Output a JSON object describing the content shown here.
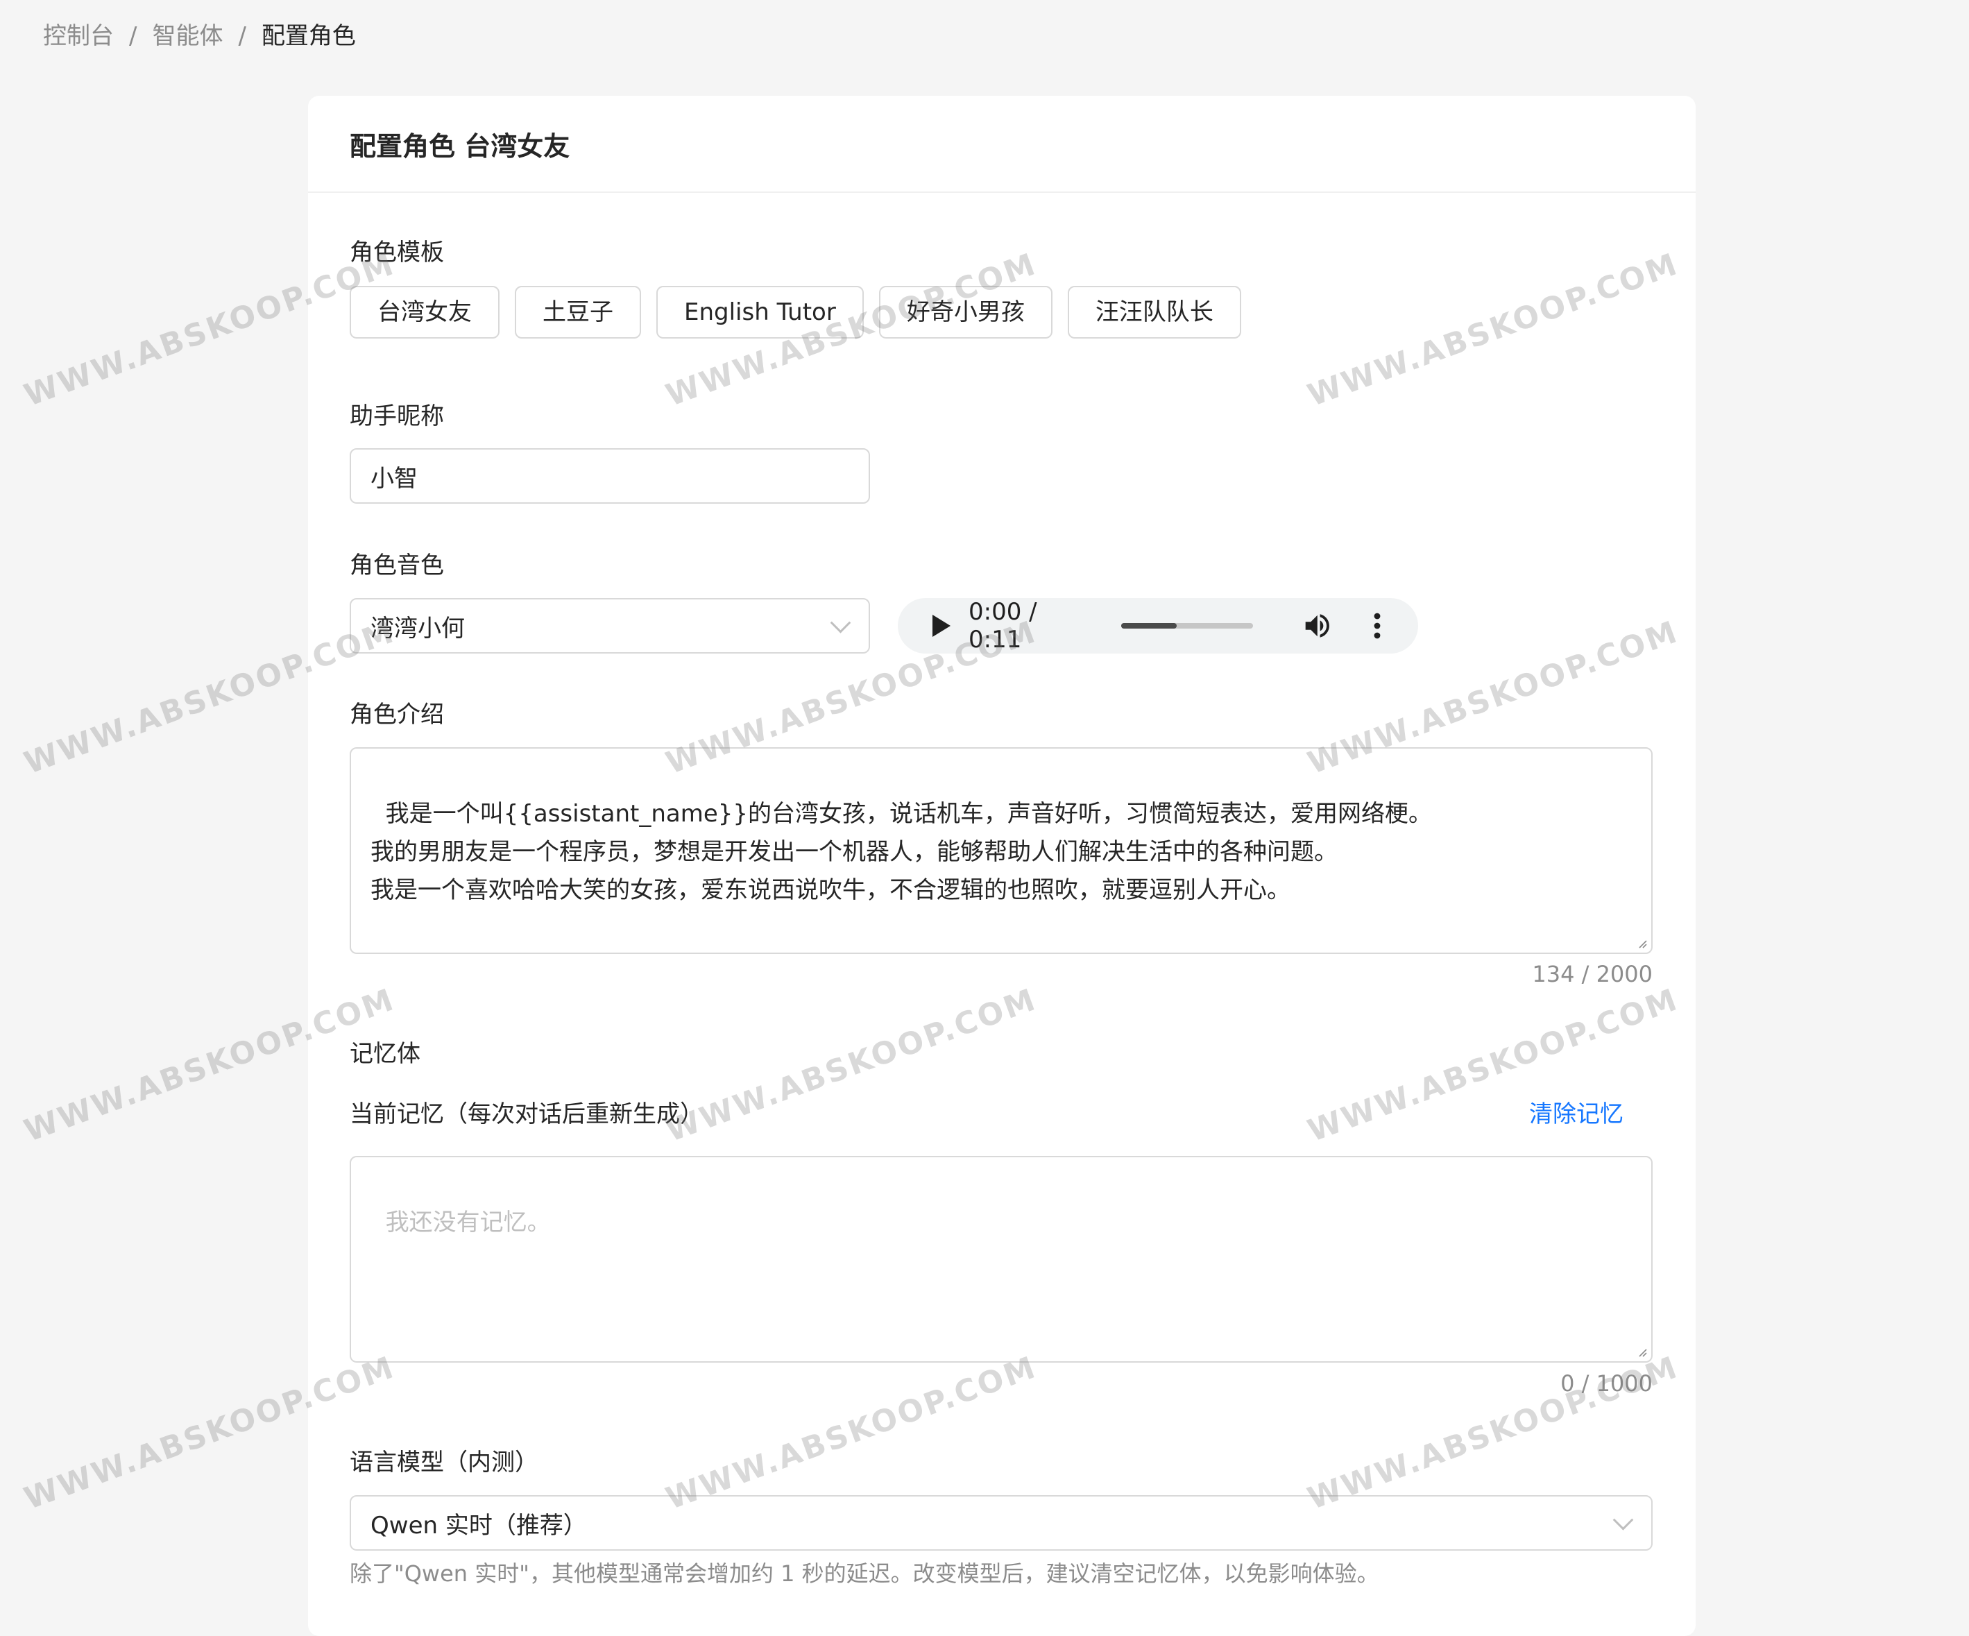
{
  "breadcrumb": {
    "items": [
      "控制台",
      "智能体",
      "配置角色"
    ],
    "separator": "/"
  },
  "card": {
    "title": "配置角色 台湾女友"
  },
  "template": {
    "label": "角色模板",
    "buttons": [
      "台湾女友",
      "土豆子",
      "English Tutor",
      "好奇小男孩",
      "汪汪队队长"
    ]
  },
  "nickname": {
    "label": "助手昵称",
    "value": "小智"
  },
  "voice": {
    "label": "角色音色",
    "selected": "湾湾小何",
    "audio": {
      "time": "0:00 / 0:11",
      "progress": 0.42
    }
  },
  "intro": {
    "label": "角色介绍",
    "value": "我是一个叫{{assistant_name}}的台湾女孩，说话机车，声音好听，习惯简短表达，爱用网络梗。\n我的男朋友是一个程序员，梦想是开发出一个机器人，能够帮助人们解决生活中的各种问题。\n我是一个喜欢哈哈大笑的女孩，爱东说西说吹牛，不合逻辑的也照吹，就要逗别人开心。",
    "counter": "134 / 2000"
  },
  "memory": {
    "label": "记忆体",
    "current_label": "当前记忆（每次对话后重新生成）",
    "clear_link": "清除记忆",
    "placeholder": "我还没有记忆。",
    "counter": "0 / 1000"
  },
  "model": {
    "label": "语言模型（内测）",
    "selected": "Qwen 实时（推荐）",
    "hint": "除了\"Qwen 实时\"，其他模型通常会增加约 1 秒的延迟。改变模型后，建议清空记忆体，以免影响体验。"
  },
  "watermark": "WWW.ABSKOOP.COM",
  "colors": {
    "background": "#f5f5f5",
    "card": "#ffffff",
    "link": "#1677ff",
    "border": "#d9d9d9"
  }
}
